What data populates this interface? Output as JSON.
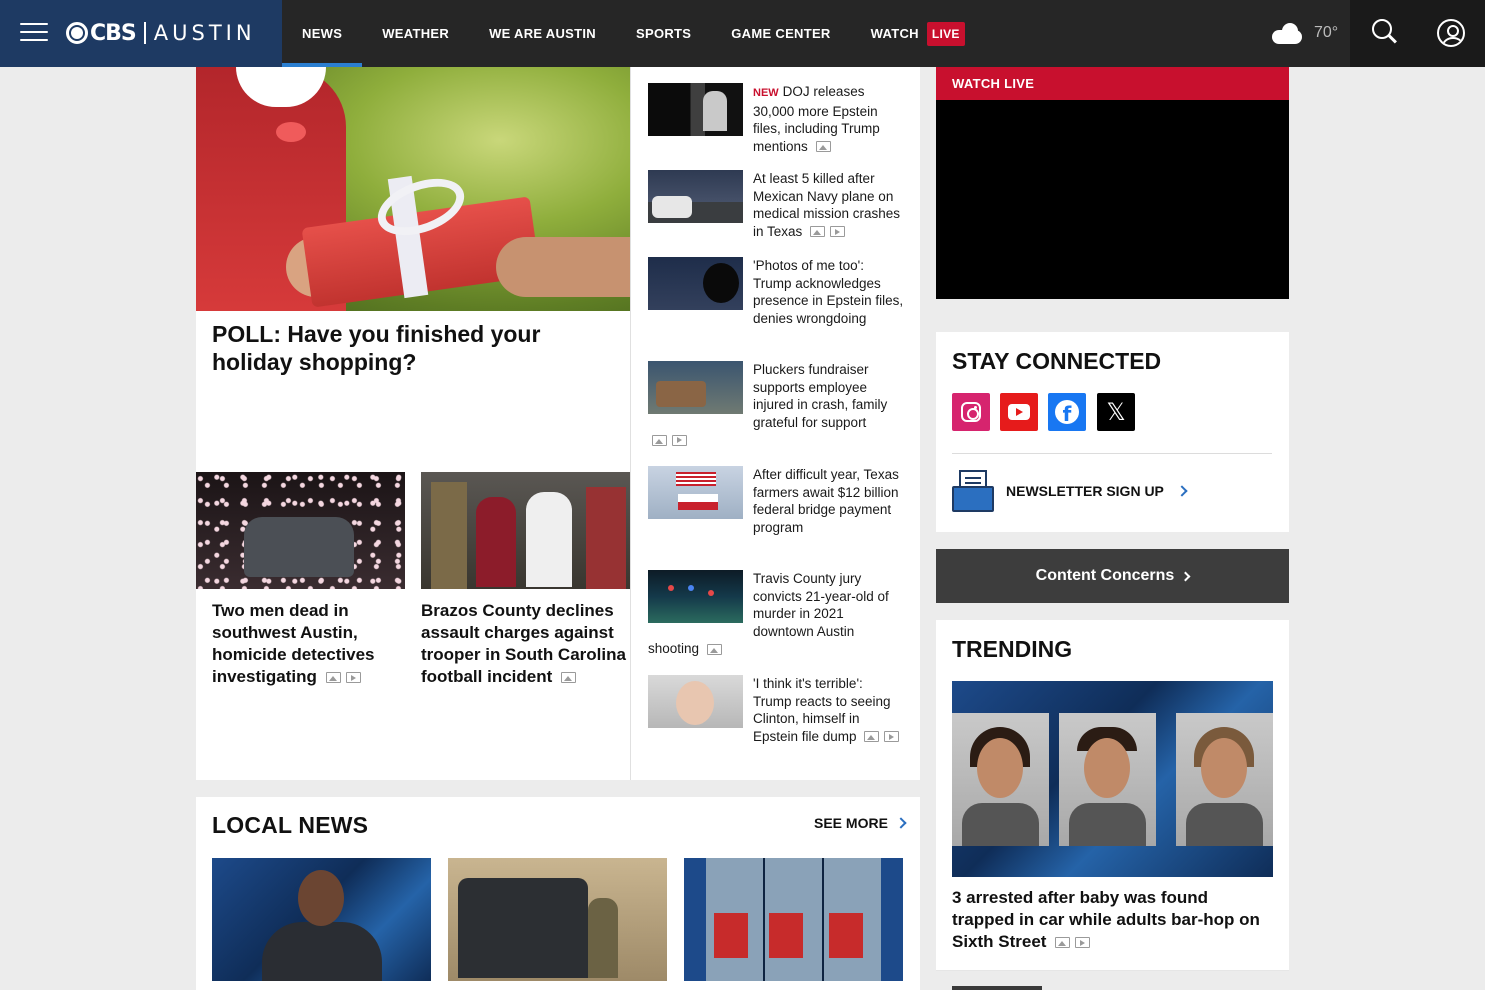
{
  "header": {
    "brand_name": "CBS",
    "brand_city": "AUSTIN",
    "nav": [
      {
        "label": "NEWS",
        "active": true
      },
      {
        "label": "WEATHER"
      },
      {
        "label": "WE ARE AUSTIN"
      },
      {
        "label": "SPORTS"
      },
      {
        "label": "GAME CENTER"
      },
      {
        "label": "WATCH"
      }
    ],
    "live_badge": "LIVE",
    "weather_icon": "cloud-icon",
    "temperature": "70°"
  },
  "hero": {
    "title": "POLL: Have you finished your holiday shopping?"
  },
  "stories": [
    {
      "title": "Two men dead in southwest Austin, homicide detectives investigating",
      "media": [
        "gallery",
        "video"
      ]
    },
    {
      "title": "Brazos County declines assault charges against trooper in South Carolina football incident",
      "media": [
        "gallery"
      ]
    }
  ],
  "side_list": [
    {
      "tag": "NEW",
      "title": "DOJ releases 30,000 more Epstein files, including Trump mentions",
      "media": [
        "gallery"
      ]
    },
    {
      "tag": "",
      "title": "At least 5 killed after Mexican Navy plane on medical mission crashes in Texas",
      "media": [
        "gallery",
        "video"
      ]
    },
    {
      "tag": "",
      "title": "'Photos of me too': Trump acknowledges presence in Epstein files, denies wrongdoing",
      "media": []
    },
    {
      "tag": "",
      "title": "Pluckers fundraiser supports employee injured in crash, family grateful for support",
      "media": [
        "gallery",
        "video"
      ]
    },
    {
      "tag": "",
      "title": "After difficult year, Texas farmers await $12 billion federal bridge payment program",
      "media": []
    },
    {
      "tag": "",
      "title": "Travis County jury convicts 21-year-old of murder in 2021 downtown Austin shooting",
      "media": [
        "gallery"
      ]
    },
    {
      "tag": "",
      "title": "'I think it's terrible': Trump reacts to seeing Clinton, himself in Epstein file dump",
      "media": [
        "gallery",
        "video"
      ]
    }
  ],
  "local_news": {
    "title": "LOCAL NEWS",
    "see_more": "SEE MORE"
  },
  "right": {
    "watch_live": "WATCH LIVE",
    "stay_connected": "STAY CONNECTED",
    "social": [
      "instagram-icon",
      "youtube-icon",
      "facebook-icon",
      "x-icon"
    ],
    "newsletter": "NEWSLETTER SIGN UP",
    "content_concerns": "Content Concerns",
    "trending_title": "TRENDING",
    "trending_headline": "3 arrested after baby was found trapped in car while adults bar-hop on Sixth Street"
  },
  "colors": {
    "brand_navy": "#1e3a63",
    "header_bg": "#262626",
    "live_red": "#c8102e",
    "accent_blue": "#2b7fd1"
  }
}
